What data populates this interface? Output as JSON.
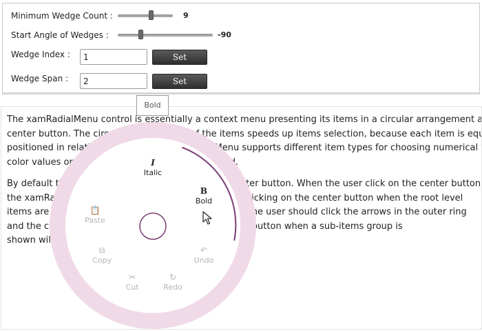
{
  "settings": {
    "min_wedge_count": {
      "label": "Minimum Wedge Count :",
      "value": "9"
    },
    "start_angle": {
      "label": "Start Angle of Wedges :",
      "value": "-90"
    },
    "wedge_index": {
      "label": "Wedge Index :",
      "value": "1",
      "button": "Set"
    },
    "wedge_span": {
      "label": "Wedge Span :",
      "value": "2",
      "button": "Set"
    }
  },
  "tooltip": "Bold",
  "description": {
    "para1_lines": [
      "The xamRadialMenu control is essentially a context menu presenting its items in a circular arrangement around a",
      "center button. The circular arrangement of the items speeds up items selection, because each item is equally",
      "positioned in relation to the center. xamRadialMenu supports different item types for choosing numerical values,",
      "color values or regular items, whose are supported."
    ],
    "para2_lines": [
      "By default the menu items are visible around the center button. When the user click on the center button",
      "the xamRadialMenu is shrink and it hides the items. Clicking on the center button when the root level",
      "items are shown closes the menu. To show sub-Items the user should click the arrows in the outer ring",
      "and the control will show them. Clicking on the center button when a sub-items group is",
      "shown will return to the previous level."
    ]
  },
  "radial_menu": {
    "colors": {
      "ring": "#f0dae8",
      "inner": "#ffffff",
      "accent": "#7a3b72",
      "disabled": "#b4b4b4"
    },
    "items": {
      "italic": {
        "label": "Italic",
        "glyph": "I",
        "icon": "italic-icon",
        "enabled": true
      },
      "bold": {
        "label": "Bold",
        "glyph": "B",
        "icon": "bold-icon",
        "enabled": true
      },
      "paste": {
        "label": "Paste",
        "glyph": "📋",
        "icon": "paste-icon",
        "enabled": false
      },
      "copy": {
        "label": "Copy",
        "glyph": "⧉",
        "icon": "copy-icon",
        "enabled": false
      },
      "cut": {
        "label": "Cut",
        "glyph": "✂",
        "icon": "scissors-icon",
        "enabled": false
      },
      "redo": {
        "label": "Redo",
        "glyph": "↻",
        "icon": "redo-icon",
        "enabled": false
      },
      "undo": {
        "label": "Undo",
        "glyph": "↶",
        "icon": "undo-icon",
        "enabled": false
      }
    }
  }
}
